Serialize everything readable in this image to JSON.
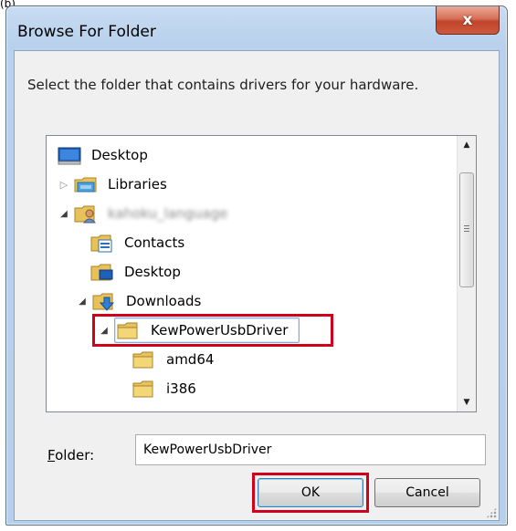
{
  "fragment": "(b)",
  "window": {
    "title": "Browse For Folder",
    "close_glyph": "x"
  },
  "instruction": "Select the folder that contains drivers for your hardware.",
  "tree": {
    "items": [
      {
        "label": "Desktop",
        "icon": "desktop-icon",
        "expander": "none"
      },
      {
        "label": "Libraries",
        "icon": "libraries-icon",
        "expander": "collapsed"
      },
      {
        "label": "kahoku_language",
        "icon": "user-folder-icon",
        "expander": "expanded"
      },
      {
        "label": "Contacts",
        "icon": "contacts-icon",
        "expander": "none"
      },
      {
        "label": "Desktop",
        "icon": "desktop-folder-icon",
        "expander": "none"
      },
      {
        "label": "Downloads",
        "icon": "downloads-icon",
        "expander": "expanded"
      },
      {
        "label": "KewPowerUsbDriver",
        "icon": "folder-icon",
        "expander": "expanded",
        "selected": true
      },
      {
        "label": "amd64",
        "icon": "folder-icon",
        "expander": "none"
      },
      {
        "label": "i386",
        "icon": "folder-icon",
        "expander": "none"
      }
    ]
  },
  "folder_field": {
    "label_accel": "F",
    "label_rest": "older:",
    "value": "KewPowerUsbDriver"
  },
  "buttons": {
    "ok": "OK",
    "cancel": "Cancel"
  },
  "colors": {
    "highlight": "#d0021b",
    "selection_border": "#84acdd",
    "title_gradient": "#b9d1ec"
  }
}
